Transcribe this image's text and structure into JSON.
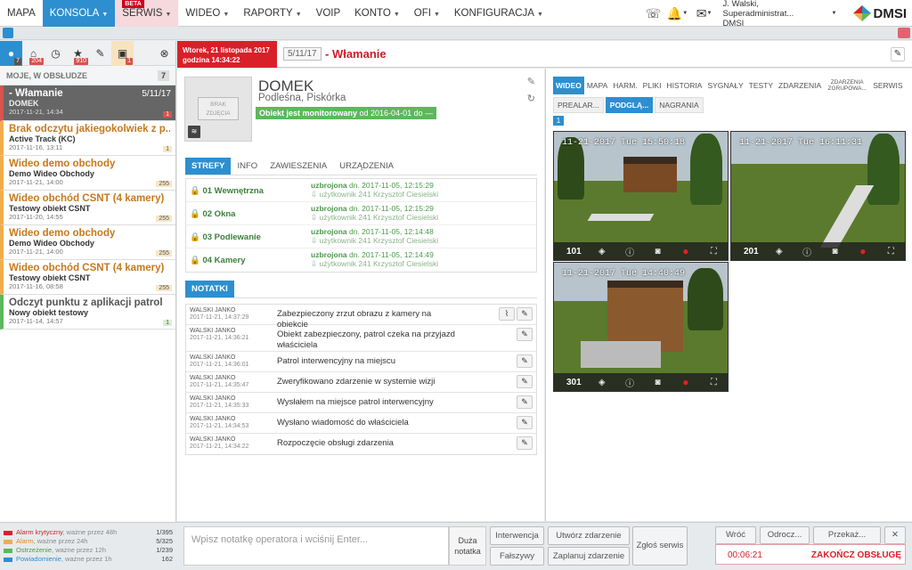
{
  "nav": {
    "items": [
      {
        "label": "MAPA"
      },
      {
        "label": "KONSOLA",
        "caret": "▼"
      },
      {
        "label": "SERWIS",
        "caret": "▼",
        "badge": "BETA"
      },
      {
        "label": "WIDEO",
        "caret": "▼"
      },
      {
        "label": "RAPORTY",
        "caret": "▼"
      },
      {
        "label": "VOIP"
      },
      {
        "label": "KONTO",
        "caret": "▼"
      },
      {
        "label": "OFI",
        "caret": "▼"
      },
      {
        "label": "KONFIGURACJA",
        "caret": "▼"
      }
    ],
    "user_name": "J. Walski, Superadministrat...",
    "user_org": "DMSI",
    "logo": "DMSI"
  },
  "sidebar": {
    "icons": [
      {
        "name": "user-icon",
        "glyph": "👤",
        "count": "7"
      },
      {
        "name": "home-icon",
        "glyph": "⌂",
        "count": "204"
      },
      {
        "name": "clock-icon",
        "glyph": "◷",
        "count": ""
      },
      {
        "name": "star-icon",
        "glyph": "★",
        "count": "910"
      },
      {
        "name": "wrench-icon",
        "glyph": "🔧",
        "count": ""
      },
      {
        "name": "car-icon",
        "glyph": "🚗",
        "count": "1"
      },
      {
        "name": "settings-icon",
        "glyph": "⊗",
        "count": ""
      }
    ],
    "header": "MOJE, W OBSŁUDZE",
    "header_count": "7",
    "cases": [
      {
        "title": "- Włamanie",
        "right": "5/11/17",
        "sub": "DOMEK",
        "date": "2017-11-21, 14:34",
        "badge": "1"
      },
      {
        "title": "Brak odczytu jakiegokolwiek z p...",
        "sub": "Active Track (KC)",
        "date": "2017-11-16, 13:11",
        "badge": "1"
      },
      {
        "title": "Wideo demo obchody",
        "sub": "Demo Wideo Obchody",
        "date": "2017-11-21, 14:00",
        "badge": "255"
      },
      {
        "title": "Wideo obchód CSNT (4 kamery)",
        "sub": "Testowy obiekt CSNT",
        "date": "2017-11-20, 14:55",
        "badge": "255"
      },
      {
        "title": "Wideo demo obchody",
        "sub": "Demo Wideo Obchody",
        "date": "2017-11-21, 14:00",
        "badge": "255"
      },
      {
        "title": "Wideo obchód CSNT (4 kamery)",
        "sub": "Testowy obiekt CSNT",
        "date": "2017-11-16, 08:58",
        "badge": "255"
      },
      {
        "title": "Odczyt punktu z aplikacji patrol",
        "sub": "Nowy obiekt testowy",
        "date": "2017-11-14, 14:57",
        "badge": "1"
      }
    ]
  },
  "header": {
    "date_line1": "Wtorek, 21 listopada 2017",
    "date_line2": "godzina 14:34:22",
    "case_id": "5/11/17",
    "title": "- Włamanie"
  },
  "object": {
    "photo_label": "BRAK ZDJĘCIA",
    "name": "DOMEK",
    "address": "Podleśna, Piskórka",
    "status_bold": "Obiekt jest monitorowany",
    "status_rest": " od 2016-04-01 do —",
    "tabs": [
      "STREFY",
      "INFO",
      "ZAWIESZENIA",
      "URZĄDZENIA"
    ],
    "zones": [
      {
        "name": "01 Wewnętrzna",
        "state": "uzbrojona",
        "when": " dn. 2017-11-05, 12:15:29",
        "user": "użytkownik 241 Krzysztof Ciesielski"
      },
      {
        "name": "02 Okna",
        "state": "uzbrojona",
        "when": " dn. 2017-11-05, 12:15:29",
        "user": "użytkownik 241 Krzysztof Ciesielski"
      },
      {
        "name": "03 Podlewanie",
        "state": "uzbrojona",
        "when": " dn. 2017-11-05, 12:14:48",
        "user": "użytkownik 241 Krzysztof Ciesielski"
      },
      {
        "name": "04 Kamery",
        "state": "uzbrojona",
        "when": " dn. 2017-11-05, 12:14:49",
        "user": "użytkownik 241 Krzysztof Ciesielski"
      }
    ],
    "notes_tab": "NOTATKI",
    "notes": [
      {
        "author": "WALSKI JANKO",
        "date": "2017-11-21, 14:37:29",
        "text": "Zabezpieczony zrzut obrazu z kamery na obiekcie",
        "attach": true
      },
      {
        "author": "WALSKI JANKO",
        "date": "2017-11-21, 14:36:21",
        "text": "Obiekt zabezpieczony, patrol czeka na przyjazd właściciela"
      },
      {
        "author": "WALSKI JANKO",
        "date": "2017-11-21, 14:36:01",
        "text": "Patrol interwencyjny na miejscu"
      },
      {
        "author": "WALSKI JANKO",
        "date": "2017-11-21, 14:35:47",
        "text": "Zweryfikowano zdarzenie w systemie wizji"
      },
      {
        "author": "WALSKI JANKO",
        "date": "2017-11-21, 14:35:33",
        "text": "Wysłałem na miejsce patrol interwencyjny"
      },
      {
        "author": "WALSKI JANKO",
        "date": "2017-11-21, 14:34:53",
        "text": "Wysłano wiadomość do właściciela"
      },
      {
        "author": "WALSKI JANKO",
        "date": "2017-11-21, 14:34:22",
        "text": "Rozpoczęcie obsługi zdarzenia"
      }
    ]
  },
  "video": {
    "tabs": [
      "WIDEO",
      "MAPA",
      "HARM.",
      "PLIKI",
      "HISTORIA",
      "SYGNAŁY",
      "TESTY",
      "ZDARZENIA",
      "ZDARZENIA ZGRUPOWA...",
      "SERWIS"
    ],
    "subtabs": [
      "PREALAR...",
      "PODGLĄ...",
      "NAGRANIA"
    ],
    "page": "1",
    "cams": [
      {
        "num": "101",
        "ts": "11-21-2017 Tue 15:50:18"
      },
      {
        "num": "201",
        "ts": "11-21-2017 Tue 16:11:31"
      },
      {
        "num": "301",
        "ts": "11-21-2017 Tue 14:40:49"
      }
    ]
  },
  "footer": {
    "legend": [
      {
        "label": "Alarm krytyczny",
        "hint": ", ważne przez 48h",
        "value": "1/395",
        "color": "#d9202a"
      },
      {
        "label": "Alarm",
        "hint": ", ważne przez 24h",
        "value": "5/325",
        "color": "#f0ad4e"
      },
      {
        "label": "Ostrzeżenie",
        "hint": ", ważne przez 12h",
        "value": "1/239",
        "color": "#5cb85c"
      },
      {
        "label": "Powiadomienie",
        "hint": ", ważne przez 1h",
        "value": "162",
        "color": "#2d8fcf"
      }
    ],
    "note_placeholder": "Wpisz notatkę operatora i wciśnij Enter...",
    "big_note": "Duża notatka",
    "interwencja": "Interwencja",
    "falszywy": "Fałszywy",
    "utworz": "Utwórz zdarzenie",
    "zaplanuj": "Zaplanuj zdarzenie",
    "zglos": "Zgłoś serwis",
    "wroc": "Wróć",
    "odrocz": "Odrocz...",
    "przekaz": "Przekaż...",
    "close": "✕",
    "timer": "00:06:21",
    "zakoncz": "ZAKOŃCZ OBSŁUGĘ"
  }
}
